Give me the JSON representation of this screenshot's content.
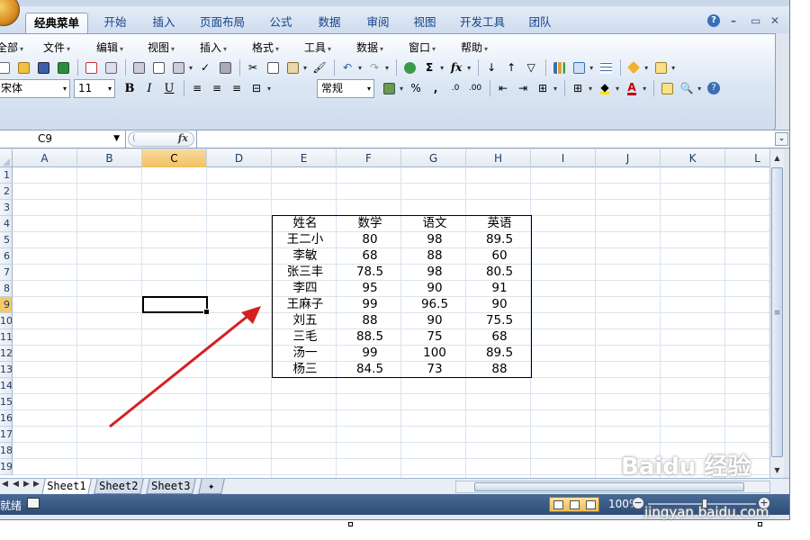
{
  "window": {
    "tabs": [
      "经典菜单",
      "开始",
      "插入",
      "页面布局",
      "公式",
      "数据",
      "审阅",
      "视图",
      "开发工具",
      "团队"
    ],
    "active_tab": 0,
    "help_icon": "help-icon",
    "controls": [
      "minimize-icon",
      "restore-icon",
      "close-icon"
    ]
  },
  "menubar": [
    "全部",
    "文件",
    "编辑",
    "视图",
    "插入",
    "格式",
    "工具",
    "数据",
    "窗口",
    "帮助"
  ],
  "formatting": {
    "font_name": "宋体",
    "font_size": "11",
    "number_format": "常规",
    "bold": "B",
    "italic": "I",
    "underline": "U",
    "percent": "%",
    "comma": ",",
    "sum": "Σ",
    "fx": "fx"
  },
  "formula_bar": {
    "name_box": "C9",
    "fx_label": "fx",
    "formula": ""
  },
  "columns": [
    "A",
    "B",
    "C",
    "D",
    "E",
    "F",
    "G",
    "H",
    "I",
    "J",
    "K",
    "L"
  ],
  "selected_column": "C",
  "rows": [
    "1",
    "2",
    "3",
    "4",
    "5",
    "6",
    "7",
    "8",
    "9",
    "10",
    "11",
    "12",
    "13",
    "14",
    "15",
    "16",
    "17",
    "18",
    "19"
  ],
  "selected_row": "9",
  "selected_cell": "C9",
  "table": {
    "headers": [
      "姓名",
      "数学",
      "语文",
      "英语"
    ],
    "rows": [
      [
        "王二小",
        "80",
        "98",
        "89.5"
      ],
      [
        "李敏",
        "68",
        "88",
        "60"
      ],
      [
        "张三丰",
        "78.5",
        "98",
        "80.5"
      ],
      [
        "李四",
        "95",
        "90",
        "91"
      ],
      [
        "王麻子",
        "99",
        "96.5",
        "90"
      ],
      [
        "刘五",
        "88",
        "90",
        "75.5"
      ],
      [
        "三毛",
        "88.5",
        "75",
        "68"
      ],
      [
        "汤一",
        "99",
        "100",
        "89.5"
      ],
      [
        "杨三",
        "84.5",
        "73",
        "88"
      ]
    ]
  },
  "sheets": [
    "Sheet1",
    "Sheet2",
    "Sheet3"
  ],
  "active_sheet": 0,
  "status": {
    "ready": "就绪",
    "zoom": "100%"
  },
  "watermark": {
    "brand": "Baidu 经验",
    "site": "jingyan.baidu.com"
  },
  "annotation": {
    "color": "#d42020"
  }
}
